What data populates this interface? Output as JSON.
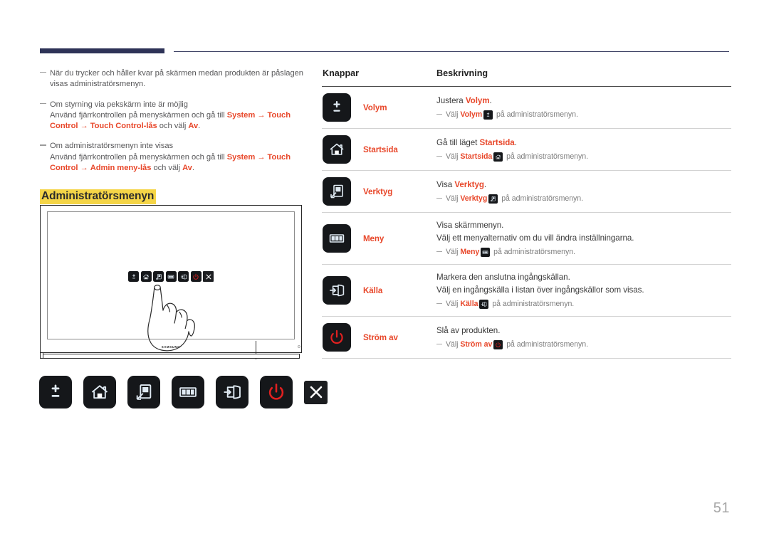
{
  "page": {
    "number": "51",
    "section_title": "Administratörsmenyn"
  },
  "notes": [
    {
      "segments": [
        {
          "t": "När du trycker och håller kvar på skärmen medan produkten är påslagen visas administratörsmenyn.",
          "style": "plain"
        }
      ]
    },
    {
      "segments": [
        {
          "t": "Om styrning via pekskärm inte är möjlig",
          "style": "plain"
        },
        {
          "t": "\n",
          "style": "break"
        },
        {
          "t": "Använd fjärrkontrollen på menyskärmen och gå till ",
          "style": "plain"
        },
        {
          "t": "System",
          "style": "hl"
        },
        {
          "t": " → ",
          "style": "arrow"
        },
        {
          "t": "Touch Control",
          "style": "hl"
        },
        {
          "t": " → ",
          "style": "arrow"
        },
        {
          "t": "Touch Control-lås",
          "style": "hl"
        },
        {
          "t": " och välj ",
          "style": "plain"
        },
        {
          "t": "Av",
          "style": "hl"
        },
        {
          "t": ".",
          "style": "plain"
        }
      ]
    },
    {
      "segments": [
        {
          "t": "Om administratörsmenyn inte visas",
          "style": "plain"
        },
        {
          "t": "\n",
          "style": "break"
        },
        {
          "t": "Använd fjärrkontrollen på menyskärmen och gå till ",
          "style": "plain"
        },
        {
          "t": "System",
          "style": "hl"
        },
        {
          "t": " → ",
          "style": "arrow"
        },
        {
          "t": "Touch Control",
          "style": "hl"
        },
        {
          "t": " → ",
          "style": "arrow"
        },
        {
          "t": "Admin meny-lås",
          "style": "hl"
        },
        {
          "t": " och välj ",
          "style": "plain"
        },
        {
          "t": "Av",
          "style": "hl"
        },
        {
          "t": ".",
          "style": "plain"
        }
      ]
    }
  ],
  "illustration": {
    "brand": "SAMSUNG",
    "osd_icons": [
      "volume-icon",
      "home-icon",
      "tools-icon",
      "menu-icon",
      "source-icon",
      "power-icon",
      "close-icon"
    ]
  },
  "icon_row": [
    {
      "icon": "volume-icon",
      "label": "Volym"
    },
    {
      "icon": "home-icon",
      "label": "Startsida"
    },
    {
      "icon": "tools-icon",
      "label": "Verktyg"
    },
    {
      "icon": "menu-icon",
      "label": "Meny"
    },
    {
      "icon": "source-icon",
      "label": "Källa"
    },
    {
      "icon": "power-icon",
      "label": "Ström av"
    },
    {
      "icon": "close-icon",
      "label": "Stäng"
    }
  ],
  "table": {
    "headers": {
      "buttons": "Knappar",
      "description": "Beskrivning"
    },
    "rows": [
      {
        "icon": "volume-icon",
        "name": "Volym",
        "lines": [
          [
            {
              "t": "Justera ",
              "style": "plain"
            },
            {
              "t": "Volym",
              "style": "hl"
            },
            {
              "t": ".",
              "style": "plain"
            }
          ]
        ],
        "sub": [
          {
            "t": "Välj ",
            "style": "plain"
          },
          {
            "t": "Volym",
            "style": "hl"
          },
          {
            "t": "ICON",
            "style": "icon"
          },
          {
            "t": " på administratörsmenyn.",
            "style": "plain"
          }
        ]
      },
      {
        "icon": "home-icon",
        "name": "Startsida",
        "lines": [
          [
            {
              "t": "Gå till läget ",
              "style": "plain"
            },
            {
              "t": "Startsida",
              "style": "hl"
            },
            {
              "t": ".",
              "style": "plain"
            }
          ]
        ],
        "sub": [
          {
            "t": "Välj ",
            "style": "plain"
          },
          {
            "t": "Startsida",
            "style": "hl"
          },
          {
            "t": "ICON",
            "style": "icon"
          },
          {
            "t": " på administratörsmenyn.",
            "style": "plain"
          }
        ]
      },
      {
        "icon": "tools-icon",
        "name": "Verktyg",
        "lines": [
          [
            {
              "t": "Visa ",
              "style": "plain"
            },
            {
              "t": "Verktyg",
              "style": "hl"
            },
            {
              "t": ".",
              "style": "plain"
            }
          ]
        ],
        "sub": [
          {
            "t": "Välj ",
            "style": "plain"
          },
          {
            "t": "Verktyg",
            "style": "hl"
          },
          {
            "t": "ICON",
            "style": "icon"
          },
          {
            "t": " på administratörsmenyn.",
            "style": "plain"
          }
        ]
      },
      {
        "icon": "menu-icon",
        "name": "Meny",
        "lines": [
          [
            {
              "t": "Visa skärmmenyn.",
              "style": "plain"
            }
          ],
          [
            {
              "t": "Välj ett menyalternativ om du vill ändra inställningarna.",
              "style": "plain"
            }
          ]
        ],
        "sub": [
          {
            "t": "Välj ",
            "style": "plain"
          },
          {
            "t": "Meny",
            "style": "hl"
          },
          {
            "t": "ICON",
            "style": "icon"
          },
          {
            "t": " på administratörsmenyn.",
            "style": "plain"
          }
        ]
      },
      {
        "icon": "source-icon",
        "name": "Källa",
        "lines": [
          [
            {
              "t": "Markera den anslutna ingångskällan.",
              "style": "plain"
            }
          ],
          [
            {
              "t": "Välj en ingångskälla i listan över ingångskällor som visas.",
              "style": "plain"
            }
          ]
        ],
        "sub": [
          {
            "t": "Välj ",
            "style": "plain"
          },
          {
            "t": "Källa",
            "style": "hl"
          },
          {
            "t": "ICON",
            "style": "icon"
          },
          {
            "t": " på administratörsmenyn.",
            "style": "plain"
          }
        ]
      },
      {
        "icon": "power-icon",
        "name": "Ström av",
        "lines": [
          [
            {
              "t": "Slå av produkten.",
              "style": "plain"
            }
          ]
        ],
        "sub": [
          {
            "t": "Välj ",
            "style": "plain"
          },
          {
            "t": "Ström av",
            "style": "hl"
          },
          {
            "t": "ICON",
            "style": "icon"
          },
          {
            "t": " på administratörsmenyn.",
            "style": "plain"
          }
        ]
      }
    ]
  },
  "colors": {
    "accent_red": "#e8472a",
    "navy": "#2e3357",
    "highlight_yellow": "#f5d547",
    "icon_dark": "#15171a",
    "power_red": "#e02020",
    "page_num_gray": "#a6a6a6"
  }
}
